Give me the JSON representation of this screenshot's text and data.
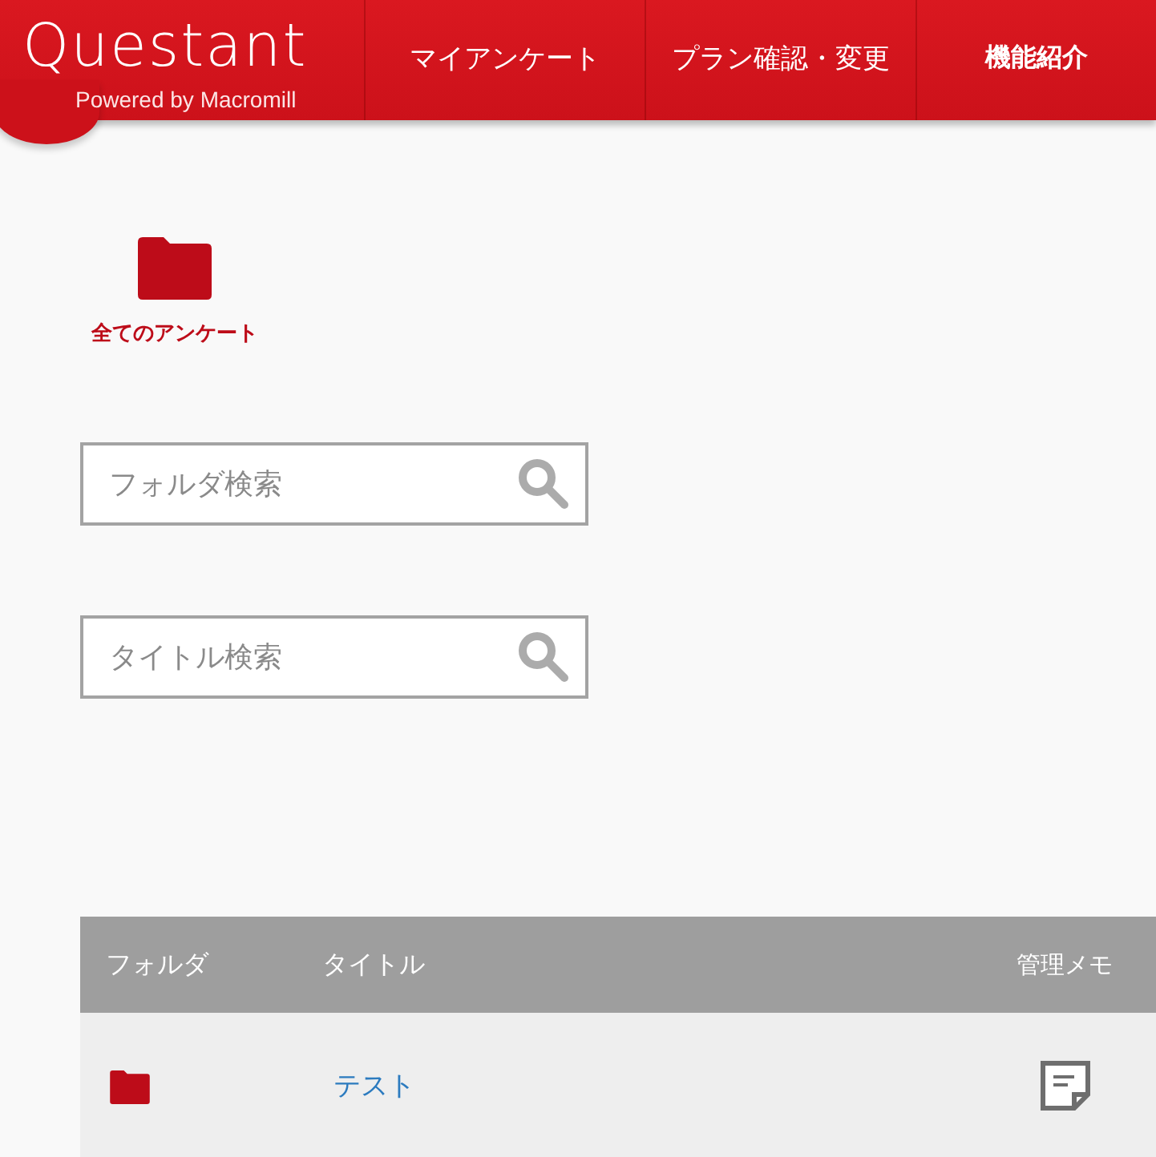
{
  "header": {
    "logo": {
      "wordmark": "Questant",
      "tagline": "Powered by Macromill"
    },
    "nav": [
      {
        "label": "マイアンケート"
      },
      {
        "label": "プラン確認・変更"
      },
      {
        "label": "機能紹介"
      }
    ]
  },
  "folder": {
    "label": "全てのアンケート"
  },
  "searches": [
    {
      "placeholder": "フォルダ検索"
    },
    {
      "placeholder": "タイトル検索"
    }
  ],
  "table": {
    "columns": [
      "フォルダ",
      "タイトル",
      "管理メモ"
    ],
    "rows": [
      {
        "title": "テスト"
      }
    ]
  }
}
